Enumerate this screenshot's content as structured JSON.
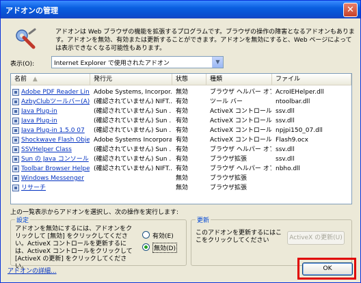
{
  "window": {
    "title": "アドオンの管理",
    "close_glyph": "✕"
  },
  "intro": "アドオンは Web ブラウザの機能を拡張するプログラムです。ブラウザの操作の障害となるアドオンもあります。アドオンを無効、有効または更新することができます。アドオンを無効にすると、Web ページによっては表示できなくなる可能性もあります。",
  "show": {
    "label": "表示(O):",
    "value": "Internet Explorer で使用されたアドオン"
  },
  "list": {
    "columns": [
      "名前",
      "発行元",
      "状態",
      "種類",
      "ファイル"
    ],
    "rows": [
      {
        "name": "Adobe PDF Reader Lin...",
        "publisher": "Adobe Systems, Incorpor...",
        "status": "無効",
        "type": "ブラウザ ヘルパー オブ...",
        "file": "AcroIEHelper.dll"
      },
      {
        "name": "AzbyClubツールバー(A)",
        "publisher": "(確認されていません) NIFT...",
        "status": "有効",
        "type": "ツール バー",
        "file": "ntoolbar.dll"
      },
      {
        "name": "Java Plug-in",
        "publisher": "(確認されていません) Sun ...",
        "status": "有効",
        "type": "ActiveX コントロール",
        "file": "ssv.dll"
      },
      {
        "name": "Java Plug-in",
        "publisher": "(確認されていません) Sun ...",
        "status": "有効",
        "type": "ActiveX コントロール",
        "file": "ssv.dll"
      },
      {
        "name": "Java Plug-in 1.5.0 07",
        "publisher": "(確認されていません) Sun ...",
        "status": "有効",
        "type": "ActiveX コントロール",
        "file": "npjpi150_07.dll"
      },
      {
        "name": "Shockwave Flash Object",
        "publisher": "Adobe Systems Incorpora...",
        "status": "有効",
        "type": "ActiveX コントロール",
        "file": "Flash9.ocx"
      },
      {
        "name": "SSVHelper Class",
        "publisher": "(確認されていません) Sun ...",
        "status": "有効",
        "type": "ブラウザ ヘルパー オブ...",
        "file": "ssv.dll"
      },
      {
        "name": "Sun の Java コンソール",
        "publisher": "(確認されていません) Sun ...",
        "status": "有効",
        "type": "ブラウザ拡張",
        "file": "ssv.dll"
      },
      {
        "name": "Toolbar Browser Helpe...",
        "publisher": "(確認されていません) NIFT...",
        "status": "有効",
        "type": "ブラウザ ヘルパー オブ...",
        "file": "nbho.dll"
      },
      {
        "name": "Windows Messenger",
        "publisher": "",
        "status": "無効",
        "type": "ブラウザ拡張",
        "file": ""
      },
      {
        "name": "リサーチ",
        "publisher": "",
        "status": "無効",
        "type": "ブラウザ拡張",
        "file": ""
      }
    ]
  },
  "help_text": "上の一覧表示からアドオンを選択し、次の操作を実行します:",
  "settings": {
    "title": "設定",
    "text": "アドオンを無効にするには、アドオンをクリックして [無効] をクリックしてください。ActiveX コントロールを更新するには、ActiveX コントロールをクリックして [ActiveX の更新] をクリックしてください。",
    "enable_label": "有効(E)",
    "disable_label": "無効(D)",
    "selected": "disable"
  },
  "update": {
    "title": "更新",
    "text": "このアドオンを更新するにはここをクリックしてください",
    "button_label": "ActiveX の更新(U)"
  },
  "details_link": "アドオンの詳細...",
  "ok_label": "OK",
  "colors": {
    "titlebar": "#0a5fe0",
    "face": "#ece9d8",
    "highlight": "#e00000",
    "link": "#0030c0"
  }
}
